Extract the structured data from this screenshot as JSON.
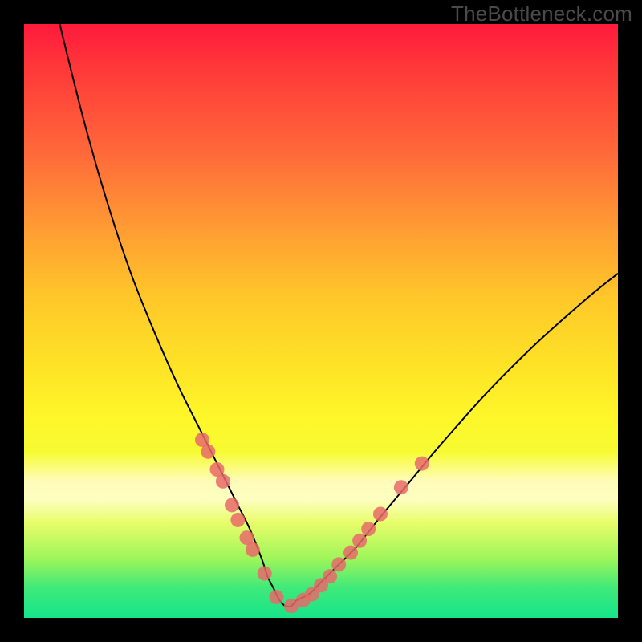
{
  "watermark": {
    "text": "TheBottleneck.com"
  },
  "chart_data": {
    "type": "line",
    "title": "",
    "xlabel": "",
    "ylabel": "",
    "xlim": [
      0,
      100
    ],
    "ylim": [
      0,
      100
    ],
    "grid": false,
    "legend": false,
    "background_gradient": {
      "top": "#ff1a3c",
      "middle": "#fee426",
      "bottom": "#15e58a"
    },
    "series": [
      {
        "name": "bottleneck-curve",
        "color": "#000000",
        "x": [
          6,
          10,
          14,
          18,
          22,
          26,
          30,
          34,
          36,
          38,
          40,
          41,
          42,
          43,
          44,
          45,
          46,
          48,
          50,
          53,
          56,
          60,
          65,
          70,
          78,
          86,
          95,
          100
        ],
        "values": [
          100,
          84,
          70,
          58,
          48,
          39,
          31,
          23,
          19,
          15,
          10,
          7,
          5,
          3,
          2,
          2,
          3,
          4,
          6,
          9,
          12,
          17,
          23,
          29,
          38,
          46,
          54,
          58
        ]
      }
    ],
    "markers": [
      {
        "name": "left-cluster",
        "color": "#e86a6a",
        "shape": "circle",
        "r": 9,
        "points": [
          {
            "x": 30.0,
            "y": 30.0
          },
          {
            "x": 31.0,
            "y": 28.0
          },
          {
            "x": 32.5,
            "y": 25.0
          },
          {
            "x": 33.5,
            "y": 23.0
          },
          {
            "x": 35.0,
            "y": 19.0
          },
          {
            "x": 36.0,
            "y": 16.5
          },
          {
            "x": 37.5,
            "y": 13.5
          },
          {
            "x": 38.5,
            "y": 11.5
          },
          {
            "x": 40.5,
            "y": 7.5
          },
          {
            "x": 42.5,
            "y": 3.5
          }
        ]
      },
      {
        "name": "right-cluster",
        "color": "#e86a6a",
        "shape": "circle",
        "r": 9,
        "points": [
          {
            "x": 45.0,
            "y": 2.0
          },
          {
            "x": 47.0,
            "y": 3.0
          },
          {
            "x": 48.5,
            "y": 4.0
          },
          {
            "x": 50.0,
            "y": 5.5
          },
          {
            "x": 51.5,
            "y": 7.0
          },
          {
            "x": 53.0,
            "y": 9.0
          },
          {
            "x": 55.0,
            "y": 11.0
          },
          {
            "x": 56.5,
            "y": 13.0
          },
          {
            "x": 58.0,
            "y": 15.0
          },
          {
            "x": 60.0,
            "y": 17.5
          },
          {
            "x": 63.5,
            "y": 22.0
          },
          {
            "x": 67.0,
            "y": 26.0
          }
        ]
      }
    ]
  }
}
